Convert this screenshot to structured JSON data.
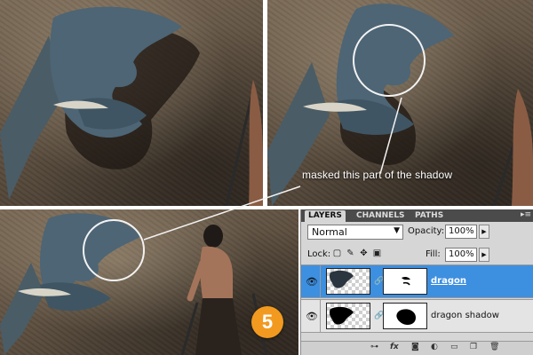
{
  "caption": "masked this part of the shadow",
  "step_number": "5",
  "layers_panel": {
    "tabs": [
      {
        "label": "LAYERS",
        "active": true
      },
      {
        "label": "CHANNELS",
        "active": false
      },
      {
        "label": "PATHS",
        "active": false
      }
    ],
    "panel_menu_icon": "panel-menu-icon",
    "blend_mode": "Normal",
    "opacity_label": "Opacity:",
    "opacity_value": "100%",
    "lock_label": "Lock:",
    "lock_icons": [
      "lock-transparent-icon",
      "lock-image-icon",
      "lock-position-icon",
      "lock-all-icon"
    ],
    "fill_label": "Fill:",
    "fill_value": "100%",
    "layers": [
      {
        "name": "dragon",
        "selected": true,
        "visible": true
      },
      {
        "name": "dragon shadow",
        "selected": false,
        "visible": true
      }
    ],
    "bottom_icons": [
      "link-layers-icon",
      "fx-icon",
      "add-mask-icon",
      "adjustment-icon",
      "group-icon",
      "new-layer-icon",
      "trash-icon"
    ]
  },
  "colors": {
    "selected_layer": "#3d8fe0",
    "step_badge": "#f29a1f"
  }
}
